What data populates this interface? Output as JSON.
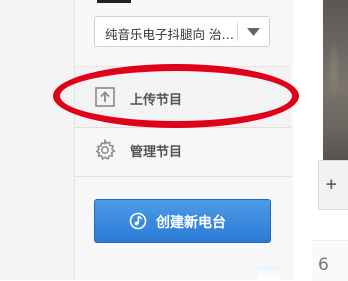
{
  "station_select": {
    "value": "纯音乐电子抖腿向 治…",
    "arrow_icon": "chevron-down-icon"
  },
  "menu": {
    "upload": {
      "label": "上传节目",
      "icon": "upload-icon"
    },
    "manage": {
      "label": "管理节目",
      "icon": "gear-icon"
    }
  },
  "create_button": {
    "label": "创建新电台",
    "icon": "radio-icon"
  },
  "right_panel": {
    "number": "6",
    "number_suffix": ""
  },
  "colors": {
    "primary_button": "#2b7bd5",
    "highlight_annotation": "#e0001a",
    "label_text": "#555555"
  }
}
